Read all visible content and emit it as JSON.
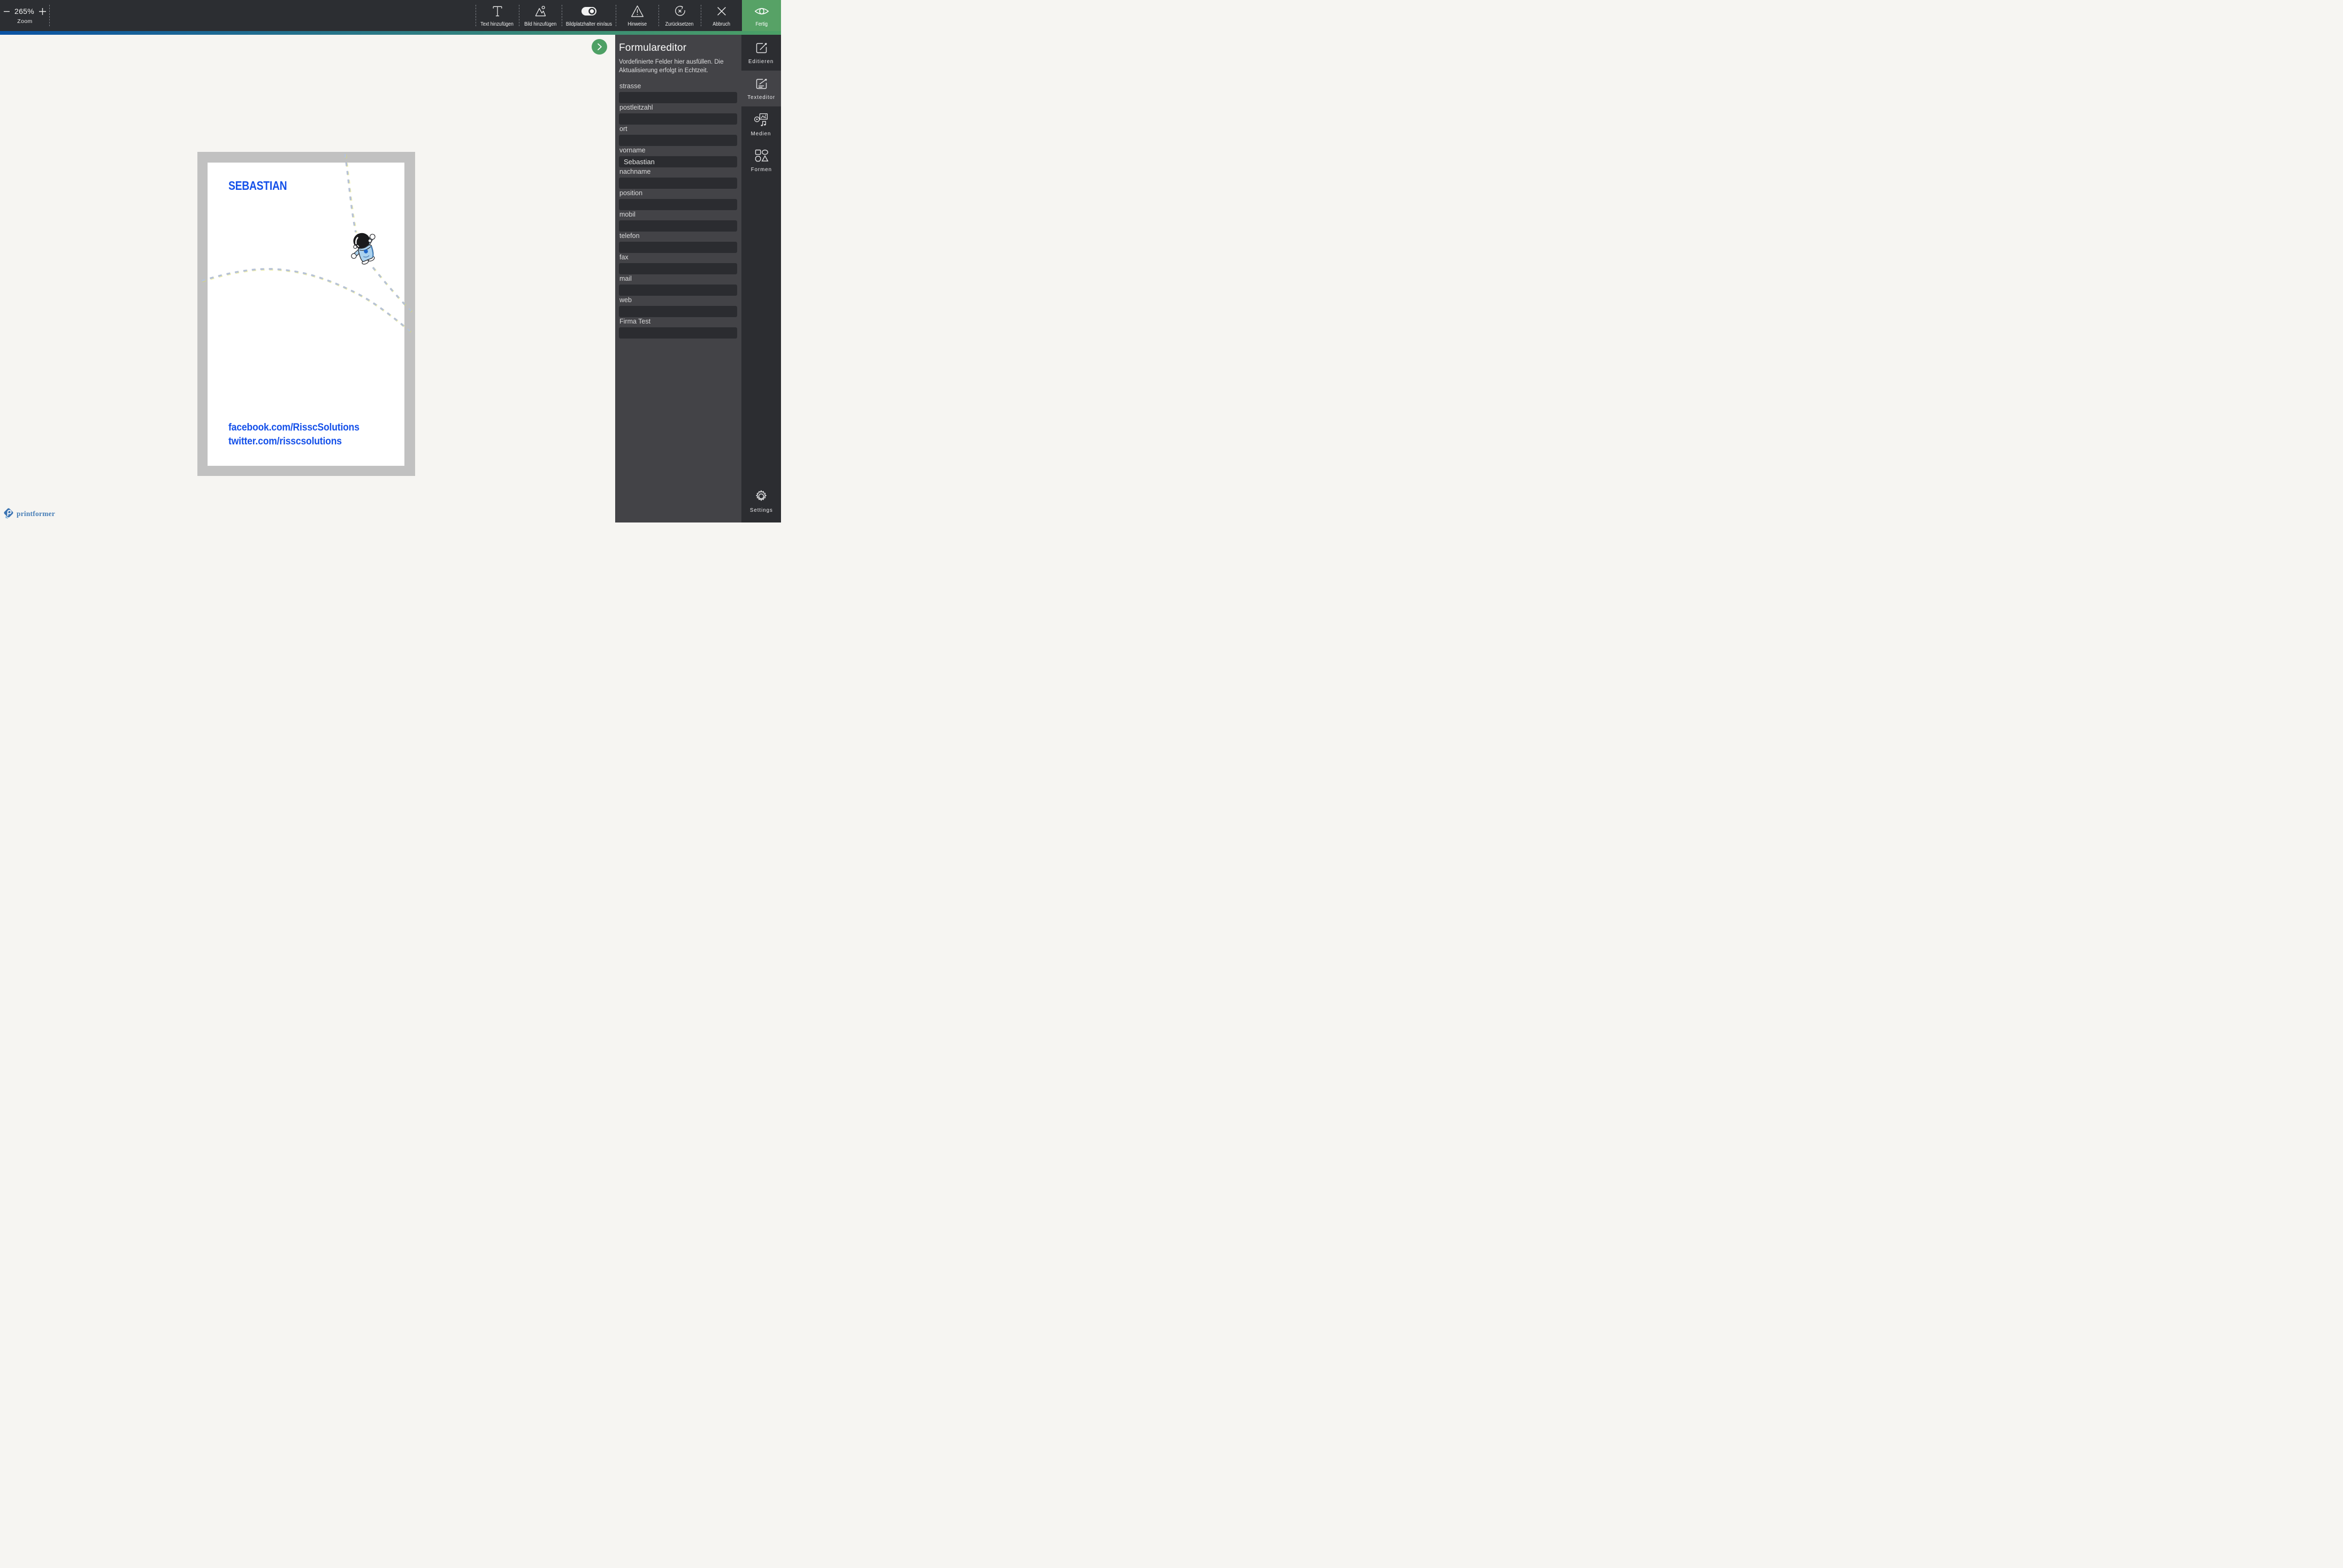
{
  "colors": {
    "topbar_bg": "#2c2e32",
    "gradient_from": "#0b53a4",
    "gradient_to": "#4ba065",
    "accent_green": "#57a266",
    "fab_green": "#4ea065",
    "canvas_bg": "#f6f5f2",
    "bleed_gray": "#c1c1c1",
    "panel_bg": "#434347",
    "input_bg": "#2b2c30",
    "card_text_blue": "#1450e9",
    "brand_blue": "#3a72b1"
  },
  "toolbar": {
    "zoom": {
      "value": "265%",
      "label": "Zoom"
    },
    "buttons": [
      {
        "label": "Text hinzufügen",
        "icon": "text-add-icon"
      },
      {
        "label": "Bild hinzufügen",
        "icon": "image-add-icon"
      },
      {
        "label": "Bildplatzhalter ein/aus",
        "icon": "placeholder-toggle-icon"
      },
      {
        "label": "Hinweise",
        "icon": "warning-icon"
      },
      {
        "label": "Zurücksetzen",
        "icon": "reset-icon"
      },
      {
        "label": "Abbruch",
        "icon": "close-icon"
      }
    ],
    "done": {
      "label": "Fertig",
      "icon": "eye-icon"
    }
  },
  "canvas": {
    "card": {
      "name_text": "SEBASTIAN",
      "link_line1": "facebook.com/RisscSolutions",
      "link_line2": "twitter.com/risscsolutions",
      "illustration": "astronaut-illustration"
    }
  },
  "panel": {
    "title": "Formulareditor",
    "subtitle": "Vordefinierte Felder hier ausfüllen. Die Aktualisierung erfolgt in Echtzeit.",
    "fields": [
      {
        "label": "strasse",
        "value": ""
      },
      {
        "label": "postleitzahl",
        "value": ""
      },
      {
        "label": "ort",
        "value": ""
      },
      {
        "label": "vorname",
        "value": "Sebastian"
      },
      {
        "label": "nachname",
        "value": ""
      },
      {
        "label": "position",
        "value": ""
      },
      {
        "label": "mobil",
        "value": ""
      },
      {
        "label": "telefon",
        "value": ""
      },
      {
        "label": "fax",
        "value": ""
      },
      {
        "label": "mail",
        "value": ""
      },
      {
        "label": "web",
        "value": ""
      },
      {
        "label": "Firma Test",
        "value": ""
      }
    ]
  },
  "sidebar": {
    "items": [
      {
        "label": "Editieren",
        "active": false
      },
      {
        "label": "Texteditor",
        "active": true
      },
      {
        "label": "Medien",
        "active": false
      },
      {
        "label": "Formen",
        "active": false
      }
    ],
    "settings_label": "Settings"
  },
  "footer": {
    "brand": "printformer"
  }
}
